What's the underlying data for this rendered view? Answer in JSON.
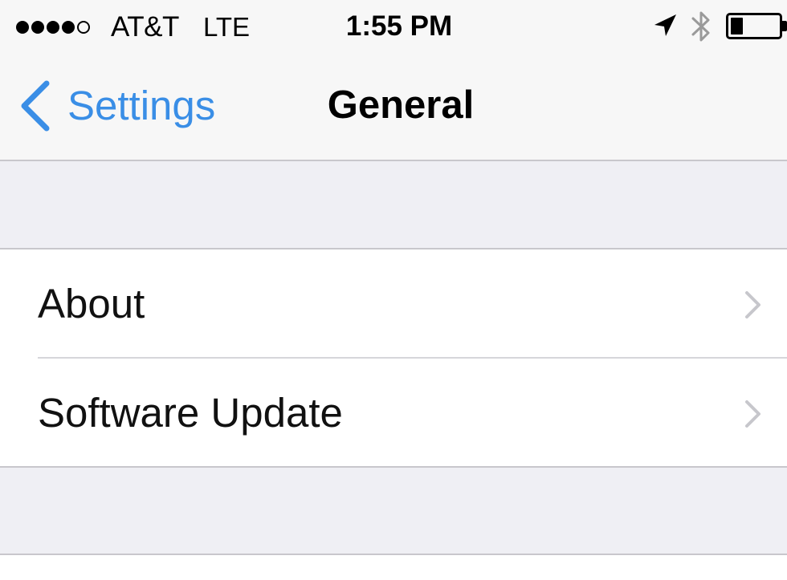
{
  "status_bar": {
    "signal_bars_filled": 4,
    "signal_bars_total": 5,
    "carrier": "AT&T",
    "network": "LTE",
    "time": "1:55 PM",
    "battery_level": 0.25,
    "icons": [
      "location-arrow-icon",
      "bluetooth-icon",
      "battery-icon"
    ]
  },
  "nav": {
    "back_label": "Settings",
    "title": "General"
  },
  "list": {
    "items": [
      {
        "label": "About",
        "icon": "chevron-right-icon"
      },
      {
        "label": "Software Update",
        "icon": "chevron-right-icon"
      }
    ]
  },
  "colors": {
    "accent": "#3a8ee6",
    "background": "#efeff4",
    "bar": "#f7f7f7",
    "separator": "#c8c7cc",
    "chevron": "#c7c7cc"
  }
}
